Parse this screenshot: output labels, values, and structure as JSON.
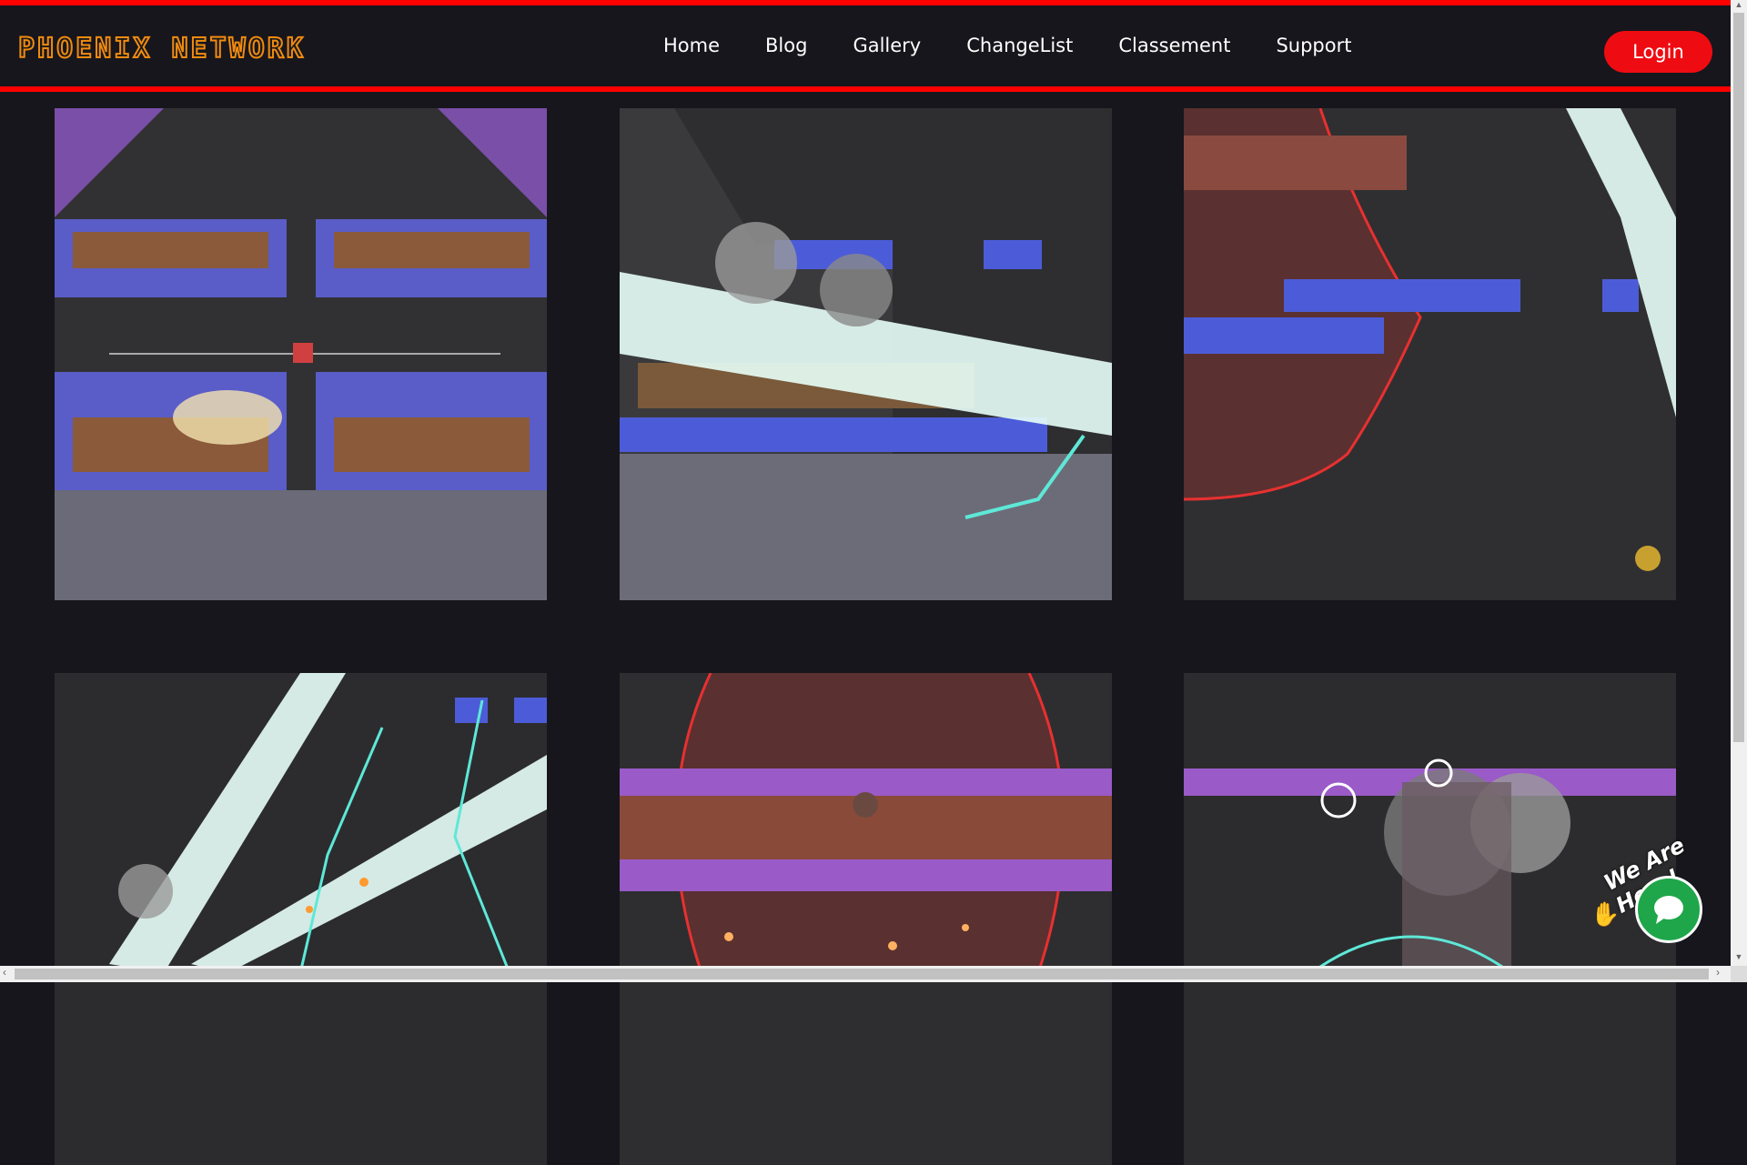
{
  "header": {
    "logo_text": "Phoenix Network",
    "nav": [
      "Home",
      "Blog",
      "Gallery",
      "ChangeList",
      "Classement",
      "Support"
    ],
    "login_label": "Login"
  },
  "gallery": {
    "tiles": [
      "screenshot-1",
      "screenshot-2",
      "screenshot-3",
      "screenshot-4",
      "screenshot-5",
      "screenshot-6"
    ]
  },
  "chat_widget": {
    "label": "We Are Here!",
    "icon": "chat-bubble-icon",
    "wave_icon": "waving-hand-icon"
  },
  "colors": {
    "accent_red": "#ff0000",
    "login_red": "#ee0c12",
    "logo_orange": "#f08a10",
    "background": "#17161c",
    "chat_green": "#1fa64a"
  }
}
